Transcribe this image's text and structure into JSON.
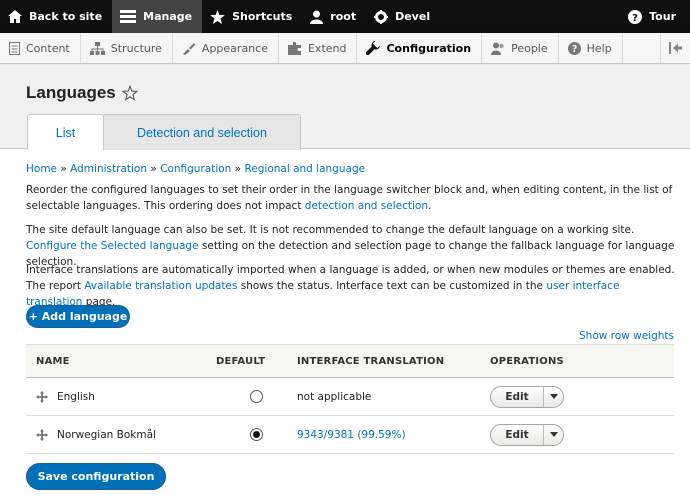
{
  "toolbar": {
    "back_label": "Back to site",
    "manage_label": "Manage",
    "shortcuts_label": "Shortcuts",
    "user_label": "root",
    "devel_label": "Devel",
    "tour_label": "Tour"
  },
  "tray": {
    "items": [
      {
        "label": "Content",
        "icon": "content-icon"
      },
      {
        "label": "Structure",
        "icon": "structure-icon"
      },
      {
        "label": "Appearance",
        "icon": "appearance-icon"
      },
      {
        "label": "Extend",
        "icon": "extend-icon"
      },
      {
        "label": "Configuration",
        "icon": "wrench-icon"
      },
      {
        "label": "People",
        "icon": "people-icon"
      },
      {
        "label": "Help",
        "icon": "help-icon"
      }
    ]
  },
  "page": {
    "title": "Languages",
    "tabs": [
      "List",
      "Detection and selection"
    ]
  },
  "breadcrumb": {
    "home": "Home",
    "admin": "Administration",
    "config": "Configuration",
    "regional": "Regional and language",
    "sep": "»"
  },
  "paragraphs": {
    "p1_text": "Reorder the configured languages to set their order in the language switcher block and, when editing content, in the list of selectable languages. This ordering does not impact ",
    "p1_link": "detection and selection",
    "p1_end": ".",
    "p2_text": "The site default language can also be set. It is not recommended to change the default language on a working site. ",
    "p2_link": "Configure the Selected language",
    "p2_end": " setting on the detection and selection page to change the fallback language for language selection.",
    "p3_text": "Interface translations are automatically imported when a language is added, or when new modules or themes are enabled. The report ",
    "p3_link1": "Available translation updates",
    "p3_mid": " shows the status. Interface text can be customized in the ",
    "p3_link2": "user interface translation",
    "p3_end": " page."
  },
  "add_language_label": "+ Add language",
  "row_weights_label": "Show row weights",
  "table": {
    "headers": [
      "NAME",
      "DEFAULT",
      "INTERFACE TRANSLATION",
      "OPERATIONS"
    ],
    "rows": [
      {
        "name": "English",
        "default": false,
        "translation": "not applicable",
        "translation_is_link": false,
        "op": "Edit"
      },
      {
        "name": "Norwegian Bokmål",
        "default": true,
        "translation": "9343/9381 (99.59%)",
        "translation_is_link": true,
        "op": "Edit"
      }
    ]
  },
  "save_label": "Save configuration",
  "colors": {
    "link": "#0074bd",
    "primary_button": "#0071b8",
    "toolbar_bg": "#0f0f0f"
  }
}
